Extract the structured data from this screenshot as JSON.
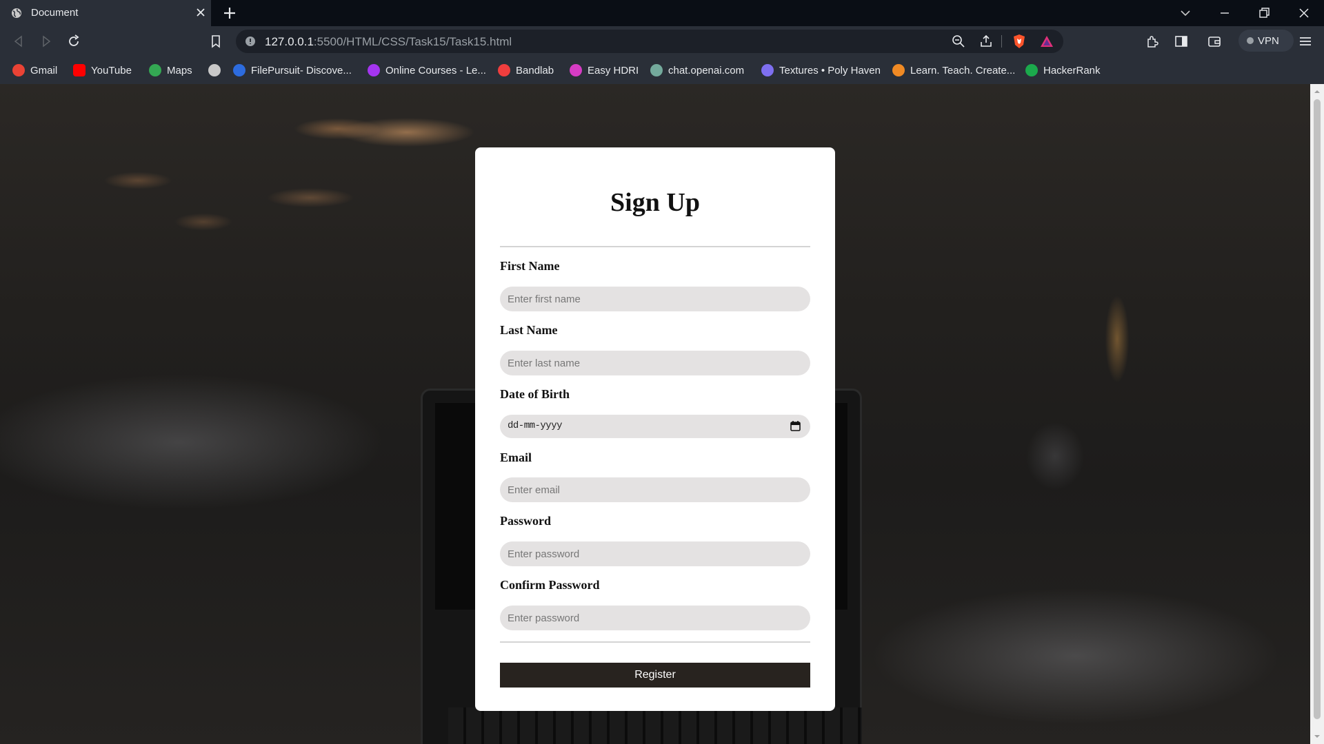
{
  "browser": {
    "tab_title": "Document",
    "url_host": "127.0.0.1",
    "url_path": ":5500/HTML/CSS/Task15/Task15.html",
    "vpn_label": "VPN"
  },
  "bookmarks": [
    {
      "label": "Gmail",
      "icon": "gmail-icon",
      "color": "#ea4335"
    },
    {
      "label": "YouTube",
      "icon": "youtube-icon",
      "color": "#ff0000"
    },
    {
      "label": "Maps",
      "icon": "maps-icon",
      "color": "#34a853"
    },
    {
      "label": "",
      "icon": "globe-icon",
      "color": "#c8c8c8"
    },
    {
      "label": "FilePursuit- Discove...",
      "icon": "filepursuit-icon",
      "color": "#2d6cdf"
    },
    {
      "label": "Online Courses - Le...",
      "icon": "udemy-icon",
      "color": "#a435f0"
    },
    {
      "label": "Bandlab",
      "icon": "bandlab-icon",
      "color": "#f03e3e"
    },
    {
      "label": "Easy HDRI",
      "icon": "easyhdri-icon",
      "color": "#d63cc4"
    },
    {
      "label": "chat.openai.com",
      "icon": "openai-icon",
      "color": "#74aa9c"
    },
    {
      "label": "Textures • Poly Haven",
      "icon": "polyhaven-icon",
      "color": "#7e6ff0"
    },
    {
      "label": "Learn. Teach. Create...",
      "icon": "learn-icon",
      "color": "#f08a24"
    },
    {
      "label": "HackerRank",
      "icon": "hackerrank-icon",
      "color": "#1ba94c"
    }
  ],
  "form": {
    "title": "Sign Up",
    "first_name_label": "First Name",
    "first_name_placeholder": "Enter first name",
    "last_name_label": "Last Name",
    "last_name_placeholder": "Enter last name",
    "dob_label": "Date of Birth",
    "dob_value": "dd-mm-yyyy",
    "email_label": "Email",
    "email_placeholder": "Enter email",
    "password_label": "Password",
    "password_placeholder": "Enter password",
    "confirm_label": "Confirm Password",
    "confirm_placeholder": "Enter password",
    "register_label": "Register"
  },
  "colors": {
    "register_bg": "#28231f",
    "input_bg": "#e4e2e2",
    "browser_chrome": "#2a2f38"
  }
}
